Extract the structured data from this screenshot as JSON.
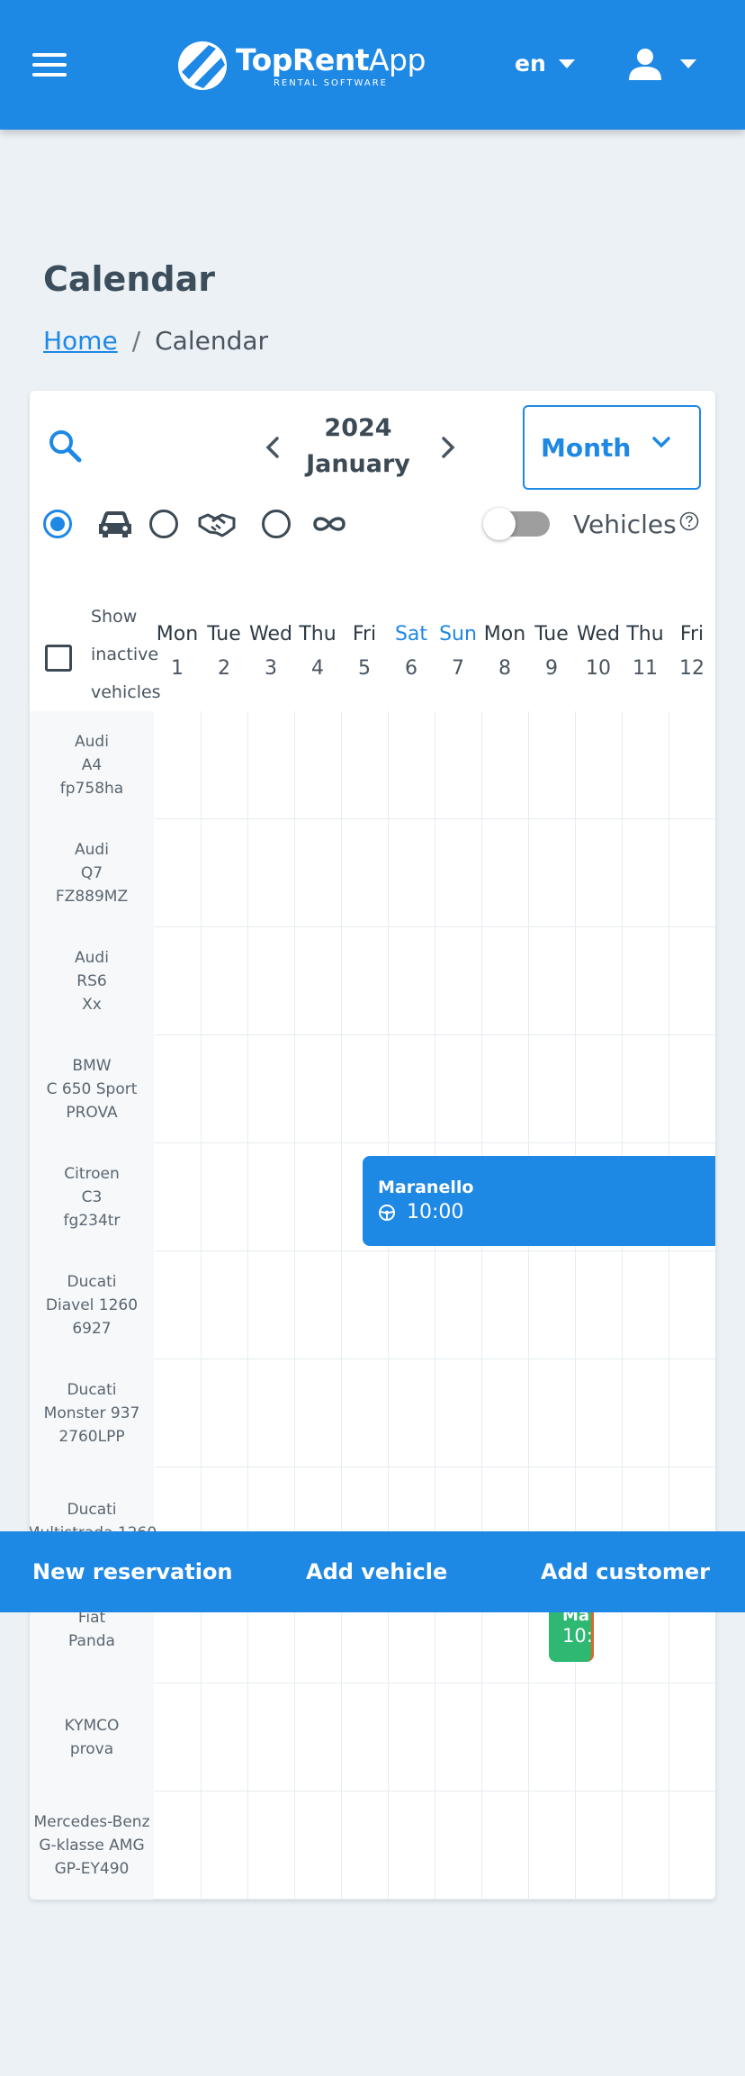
{
  "header": {
    "logo_name_bold": "TopRent",
    "logo_name_light": "App",
    "logo_tagline": "RENTAL SOFTWARE",
    "language": "en",
    "brand_color": "#1E88E5",
    "menu_icon": "hamburger-menu-icon",
    "user_icon": "user-avatar-icon"
  },
  "page": {
    "title": "Calendar",
    "breadcrumb": {
      "home": "Home",
      "separator": "/",
      "current": "Calendar"
    }
  },
  "toolbar": {
    "year": "2024",
    "month": "January",
    "view": "Month",
    "filter_selected": "vehicles",
    "toggle_label": "Vehicles",
    "toggle_on": false
  },
  "grid": {
    "show_inactive_words": [
      "Show",
      "inactive",
      "vehicles"
    ],
    "days": [
      {
        "name": "Mon",
        "num": "1",
        "weekend": false
      },
      {
        "name": "Tue",
        "num": "2",
        "weekend": false
      },
      {
        "name": "Wed",
        "num": "3",
        "weekend": false
      },
      {
        "name": "Thu",
        "num": "4",
        "weekend": false
      },
      {
        "name": "Fri",
        "num": "5",
        "weekend": false
      },
      {
        "name": "Sat",
        "num": "6",
        "weekend": true
      },
      {
        "name": "Sun",
        "num": "7",
        "weekend": true
      },
      {
        "name": "Mon",
        "num": "8",
        "weekend": false
      },
      {
        "name": "Tue",
        "num": "9",
        "weekend": false
      },
      {
        "name": "Wed",
        "num": "10",
        "weekend": false
      },
      {
        "name": "Thu",
        "num": "11",
        "weekend": false
      },
      {
        "name": "Fri",
        "num": "12",
        "weekend": false
      }
    ],
    "vehicles": [
      {
        "make": "Audi",
        "model": "A4",
        "plate": "fp758ha"
      },
      {
        "make": "Audi",
        "model": "Q7",
        "plate": "FZ889MZ"
      },
      {
        "make": "Audi",
        "model": "RS6",
        "plate": "Xx"
      },
      {
        "make": "BMW",
        "model": "C 650 Sport",
        "plate": "PROVA"
      },
      {
        "make": "Citroen",
        "model": "C3",
        "plate": "fg234tr"
      },
      {
        "make": "Ducati",
        "model": "Diavel 1260",
        "plate": "6927"
      },
      {
        "make": "Ducati",
        "model": "Monster 937",
        "plate": "2760LPP"
      },
      {
        "make": "Ducati",
        "model": "Multistrada 1260",
        "plate": ""
      },
      {
        "make": "Fiat",
        "model": "Panda",
        "plate": ""
      },
      {
        "make": "KYMCO",
        "model": "prova",
        "plate": ""
      },
      {
        "make": "Mercedes-Benz",
        "model": "G-klasse AMG",
        "plate": "GP-EY490"
      }
    ],
    "reservations": [
      {
        "title": "Maranello",
        "time": "10:00",
        "color": "#1E88E5"
      },
      {
        "title": "Ma",
        "time": "10:",
        "color": "#2EB872"
      }
    ]
  },
  "actions": {
    "new_reservation": "New reservation",
    "add_vehicle": "Add vehicle",
    "add_customer": "Add customer"
  }
}
